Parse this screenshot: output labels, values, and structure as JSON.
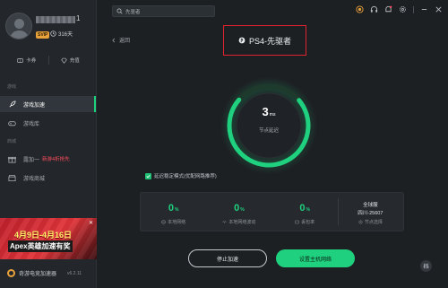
{
  "profile": {
    "name_tail": "1",
    "badge": "SVIP",
    "days_left": "316天"
  },
  "quick": {
    "recharge": "卡券",
    "task": "充值"
  },
  "sidebar": {
    "section_game": "游戏",
    "items_game": [
      {
        "label": "游戏加速",
        "icon": "rocket-icon",
        "active": true
      },
      {
        "label": "游戏库",
        "icon": "gamepad-icon",
        "active": false
      }
    ],
    "section_other": "商城",
    "items_other": [
      {
        "label": "露加一",
        "hot": "新游4折抢先",
        "icon": "gift-icon"
      },
      {
        "label": "游戏商城",
        "icon": "store-icon"
      }
    ]
  },
  "promo": {
    "line1": "4月9日-4月16日",
    "line2": "Apex英雄加速有奖"
  },
  "brand": {
    "name": "奇游电竞加速器",
    "version": "v6.2.11"
  },
  "search": {
    "value": "先驱者"
  },
  "back_label": "返回",
  "game": {
    "platform": "PS4",
    "title": "PS4-先驱者"
  },
  "latency": {
    "value": "3",
    "unit": "ms",
    "caption": "节点延迟"
  },
  "smart_mode": {
    "label": "延迟稳定模式(优配网路推荐)",
    "checked": true
  },
  "stats": {
    "packet_loss": {
      "value": "0",
      "unit": "%",
      "label": "本地网络"
    },
    "local": {
      "value": "0",
      "unit": "%",
      "label": "本地网络波动"
    },
    "loss": {
      "value": "0",
      "unit": "%",
      "label": "丢包率"
    },
    "server": {
      "line1": "全球服",
      "line2": "四川-25607",
      "label": "节点选择"
    }
  },
  "buttons": {
    "stop": "停止加速",
    "setup": "设置主机网络"
  },
  "colors": {
    "accent": "#1fd17f",
    "highlight_border": "#e0232e",
    "promo_red": "#e2353a"
  }
}
